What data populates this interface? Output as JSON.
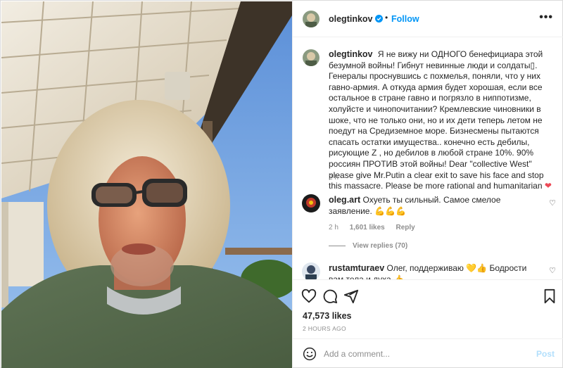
{
  "post": {
    "author": "olegtinkov",
    "follow_label": "Follow",
    "more_label": "•••",
    "photo_alt": "Selfie photo"
  },
  "caption": {
    "username": "olegtinkov",
    "text": "Я не вижу ни ОДНОГО бенефициара этой безумной войны! Гибнут невинные люди и солдаты▯. Генералы проснувшись с похмелья, поняли, что у них гавно-армия. А откуда армия будет хорошая, если все остальное в стране гавно и погрязло в ниппотизме, холуйсте и чинопочитании? Кремлевские чиновники в шоке, что не только они, но и их дети теперь летом не поедут на Средиземное море. Бизнесмены пытаются спасать остатки имущества.. конечно есть дебилы, рисующие Z , но дебилов в любой стране 10%. 90% россиян ПРОТИВ этой войны! Dear \"collective West\" please give Mr.Putin a clear exit to save his face and stop this massacre. Please be more rational and humanitarian",
    "emoji": "❤",
    "time": "2 h"
  },
  "comments": [
    {
      "username": "oleg.art",
      "text": "Охуеть ты сильный. Самое смелое заявление.",
      "emoji": "💪💪💪",
      "time": "2 h",
      "likes": "1,601 likes",
      "reply_label": "Reply",
      "view_replies": "View replies (70)",
      "heart": "♡"
    },
    {
      "username": "rustamturaev",
      "text": "Олег, поддерживаю",
      "emoji": "💛👍",
      "text2": "Бодрости вам тела и духа",
      "emoji2": "👍",
      "heart": "♡"
    }
  ],
  "actions": {
    "likes": "47,573 likes",
    "ago": "2 HOURS AGO"
  },
  "add_comment": {
    "placeholder": "Add a comment...",
    "post_label": "Post"
  },
  "colors": {
    "link_blue": "#0095f6",
    "post_disabled": "#b2dffc",
    "heart_red": "#ed4956",
    "muted": "#8e8e8e"
  }
}
